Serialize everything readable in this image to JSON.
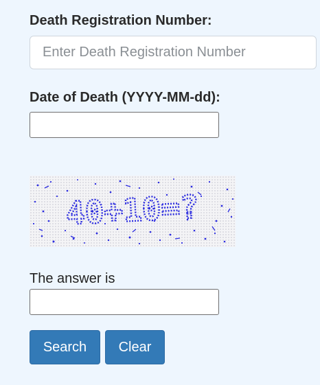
{
  "form": {
    "registration_label": "Death Registration Number:",
    "registration_placeholder": "Enter Death Registration Number",
    "registration_value": "",
    "date_label": "Date of Death (YYYY-MM-dd):",
    "date_value": "",
    "captcha_text": "40+10=?",
    "answer_label": "The answer is",
    "answer_value": ""
  },
  "buttons": {
    "search_label": "Search",
    "clear_label": "Clear"
  },
  "colors": {
    "page_background": "#eef6fe",
    "button_primary": "#337ab7",
    "captcha_text": "#2b2be0"
  }
}
